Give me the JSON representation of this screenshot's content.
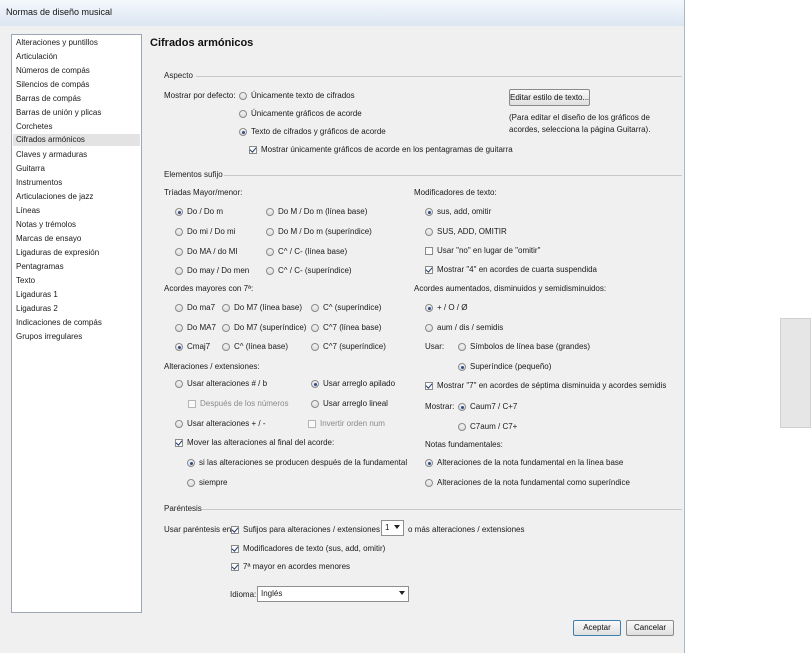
{
  "window": {
    "title": "Normas de diseño musical"
  },
  "sidebar": {
    "items": [
      "Alteraciones y puntillos",
      "Articulación",
      "Números de compás",
      "Silencios de compás",
      "Barras de compás",
      "Barras de unión y plicas",
      "Corchetes",
      "Cifrados armónicos",
      "Claves y armaduras",
      "Guitarra",
      "Instrumentos",
      "Articulaciones de jazz",
      "Líneas",
      "Notas y trémolos",
      "Marcas de ensayo",
      "Ligaduras de expresión",
      "Pentagramas",
      "Texto",
      "Ligaduras 1",
      "Ligaduras 2",
      "Indicaciones de compás",
      "Grupos irregulares"
    ],
    "selected": "Cifrados armónicos"
  },
  "page_title": "Cifrados armónicos",
  "aspecto": {
    "title": "Aspecto",
    "show_label": "Mostrar por defecto:",
    "opt_text_only": "Únicamente texto de cifrados",
    "opt_graphics_only": "Únicamente gráficos de acorde",
    "opt_text_and_graphics": "Texto de cifrados y gráficos de acorde",
    "guitar_only": "Mostrar únicamente gráficos de acorde en los pentagramas de guitarra",
    "edit_text_style": "Editar estilo de texto...",
    "note": "(Para editar el diseño de los gráficos de acordes, selecciona la página Guitarra)."
  },
  "sufijo": {
    "title": "Elementos sufijo",
    "triads_title": "Tríadas Mayor/menor:",
    "triads": [
      "Do / Do m",
      "Do M / Do m (línea base)",
      "Do mi / Do mi",
      "Do M / Do m (superíndice)",
      "Do MA / do MI",
      "C^ / C- (línea base)",
      "Do may / Do men",
      "C^ / C- (superíndice)"
    ],
    "major7_title": "Acordes mayores con 7ª:",
    "major7": [
      "Do ma7",
      "Do M7 (línea base)",
      "C^ (superíndice)",
      "Do MA7",
      "Do M7 (superíndice)",
      "C^7 (línea base)",
      "Cmaj7",
      "C^ (línea base)",
      "C^7 (superíndice)"
    ],
    "alterations_title": "Alteraciones / extensiones:",
    "alt_sharp_flat": "Usar alteraciones # / b",
    "alt_stacked": "Usar arreglo apilado",
    "after_numbers": "Después de los números",
    "alt_linear": "Usar arreglo lineal",
    "alt_plus_minus": "Usar alteraciones + / -",
    "invert_order": "Invertir orden num",
    "move_alterations": "Mover las alteraciones al final del acorde:",
    "move_if_after": "si las alteraciones se producen después de la fundamental",
    "move_always": "siempre",
    "text_mod_title": "Modificadores de texto:",
    "text_mod_lower": "sus, add, omitir",
    "text_mod_upper": "SUS, ADD, OMITIR",
    "use_no": "Usar \"no\" en lugar de \"omitir\"",
    "show_4": "Mostrar \"4\" en acordes de cuarta suspendida",
    "aug_dim_title": "Acordes aumentados, disminuidos y semidisminuidos:",
    "aug_symbols": "+ / O / Ø",
    "aug_words": "aum / dis / semidis",
    "use_label": "Usar:",
    "use_baseline": "Símbolos de línea base (grandes)",
    "use_superscript": "Superíndice (pequeño)",
    "show_7": "Mostrar \"7\" en acordes de séptima disminuida y acordes  semidis",
    "show_label": "Mostrar:",
    "show_caum7": "Caum7 / C+7",
    "show_c7aum": "C7aum / C7+",
    "root_title": "Notas fundamentales:",
    "root_baseline": "Alteraciones de la nota fundamental en la línea base",
    "root_superscript": "Alteraciones de la nota fundamental como superíndice"
  },
  "parentesis": {
    "title": "Paréntesis",
    "use_label": "Usar paréntesis en:",
    "suffix_alterations": "Sufijos para alteraciones / extensiones",
    "count_value": "1",
    "more_label": "o más alteraciones / extensiones",
    "text_modifiers": "Modificadores de texto (sus, add, omitir)",
    "major7_minor": "7ª mayor en acordes menores"
  },
  "language": {
    "label": "Idioma:",
    "value": "Inglés"
  },
  "buttons": {
    "accept": "Aceptar",
    "cancel": "Cancelar"
  },
  "colors": {
    "window_bg": "#f0f0f0",
    "selected_item": "#e3e3e3",
    "default_button_border": "#3c7fb1"
  }
}
